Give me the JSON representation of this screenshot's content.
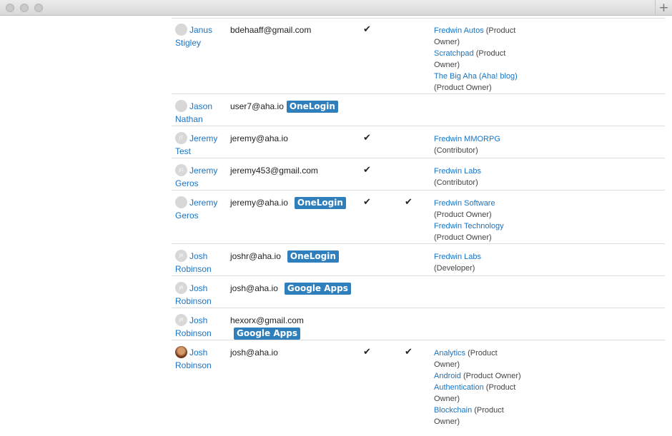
{
  "window": {
    "new_tab_label": "+"
  },
  "users": [
    {
      "name": "Janus Stigley",
      "avatar_initials": "",
      "email": "bdehaaff@gmail.com",
      "badge": "",
      "check1": "✔",
      "check2": "",
      "products": [
        {
          "name": "Fredwin Autos",
          "role": "(Product Owner)"
        },
        {
          "name": "Scratchpad",
          "role": "(Product Owner)"
        },
        {
          "name": "The Big Aha (Aha! blog)",
          "role": "(Product Owner)"
        }
      ]
    },
    {
      "name": "Jason Nathan",
      "avatar_initials": "",
      "email": "user7@aha.io",
      "badge": "OneLogin",
      "check1": "",
      "check2": "",
      "products": []
    },
    {
      "name": "Jeremy Test",
      "avatar_initials": "JT",
      "email": "jeremy@aha.io",
      "badge": "",
      "check1": "✔",
      "check2": "",
      "products": [
        {
          "name": "Fredwin MMORPG",
          "role": "(Contributor)"
        }
      ]
    },
    {
      "name": "Jeremy Geros",
      "avatar_initials": "JG",
      "email": "jeremy453@gmail.com",
      "badge": "",
      "check1": "✔",
      "check2": "",
      "products": [
        {
          "name": "Fredwin Labs",
          "role": "(Contributor)"
        }
      ]
    },
    {
      "name": "Jeremy Geros",
      "avatar_initials": "",
      "email": "jeremy@aha.io",
      "badge": "OneLogin",
      "check1": "✔",
      "check2": "✔",
      "products": [
        {
          "name": "Fredwin Software",
          "role": "(Product Owner)"
        },
        {
          "name": "Fredwin Technology",
          "role": "(Product Owner)"
        }
      ]
    },
    {
      "name": "Josh Robinson",
      "avatar_initials": "JR",
      "email": "joshr@aha.io",
      "badge": "OneLogin",
      "check1": "",
      "check2": "",
      "products": [
        {
          "name": "Fredwin Labs",
          "role": "(Developer)"
        }
      ]
    },
    {
      "name": "Josh Robinson",
      "avatar_initials": "JR",
      "email": "josh@aha.io",
      "badge": "Google Apps",
      "check1": "",
      "check2": "",
      "products": []
    },
    {
      "name": "Josh Robinson",
      "avatar_initials": "JR",
      "email": "hexorx@gmail.com",
      "badge": "Google Apps",
      "check1": "",
      "check2": "",
      "products": []
    },
    {
      "name": "Josh Robinson",
      "avatar_initials": "",
      "email": "josh@aha.io",
      "badge": "",
      "check1": "✔",
      "check2": "✔",
      "products": [
        {
          "name": "Analytics",
          "role": "(Product Owner)"
        },
        {
          "name": "Android",
          "role": "(Product Owner)"
        },
        {
          "name": "Authentication",
          "role": "(Product Owner)"
        },
        {
          "name": "Blockchain",
          "role": "(Product Owner)"
        }
      ]
    }
  ]
}
